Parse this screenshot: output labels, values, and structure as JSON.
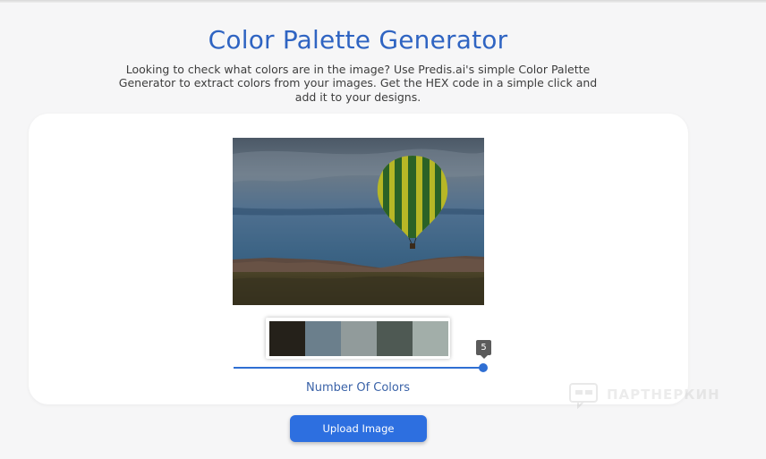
{
  "page": {
    "title": "Color Palette Generator",
    "description": "Looking to check what colors are in the image? Use Predis.ai's simple Color Palette Generator to extract colors from your images. Get the HEX code in a simple click and add it to your designs."
  },
  "palette": {
    "colors": [
      "#25211a",
      "#6b7f8c",
      "#919b9b",
      "#4e5953",
      "#a2aea9"
    ]
  },
  "slider": {
    "value": 5,
    "value_label": "5",
    "fraction": 1.0,
    "label": "Number Of Colors"
  },
  "upload": {
    "label": "Upload Image"
  },
  "watermark": {
    "text": "ПАРТНЕРКИН"
  }
}
